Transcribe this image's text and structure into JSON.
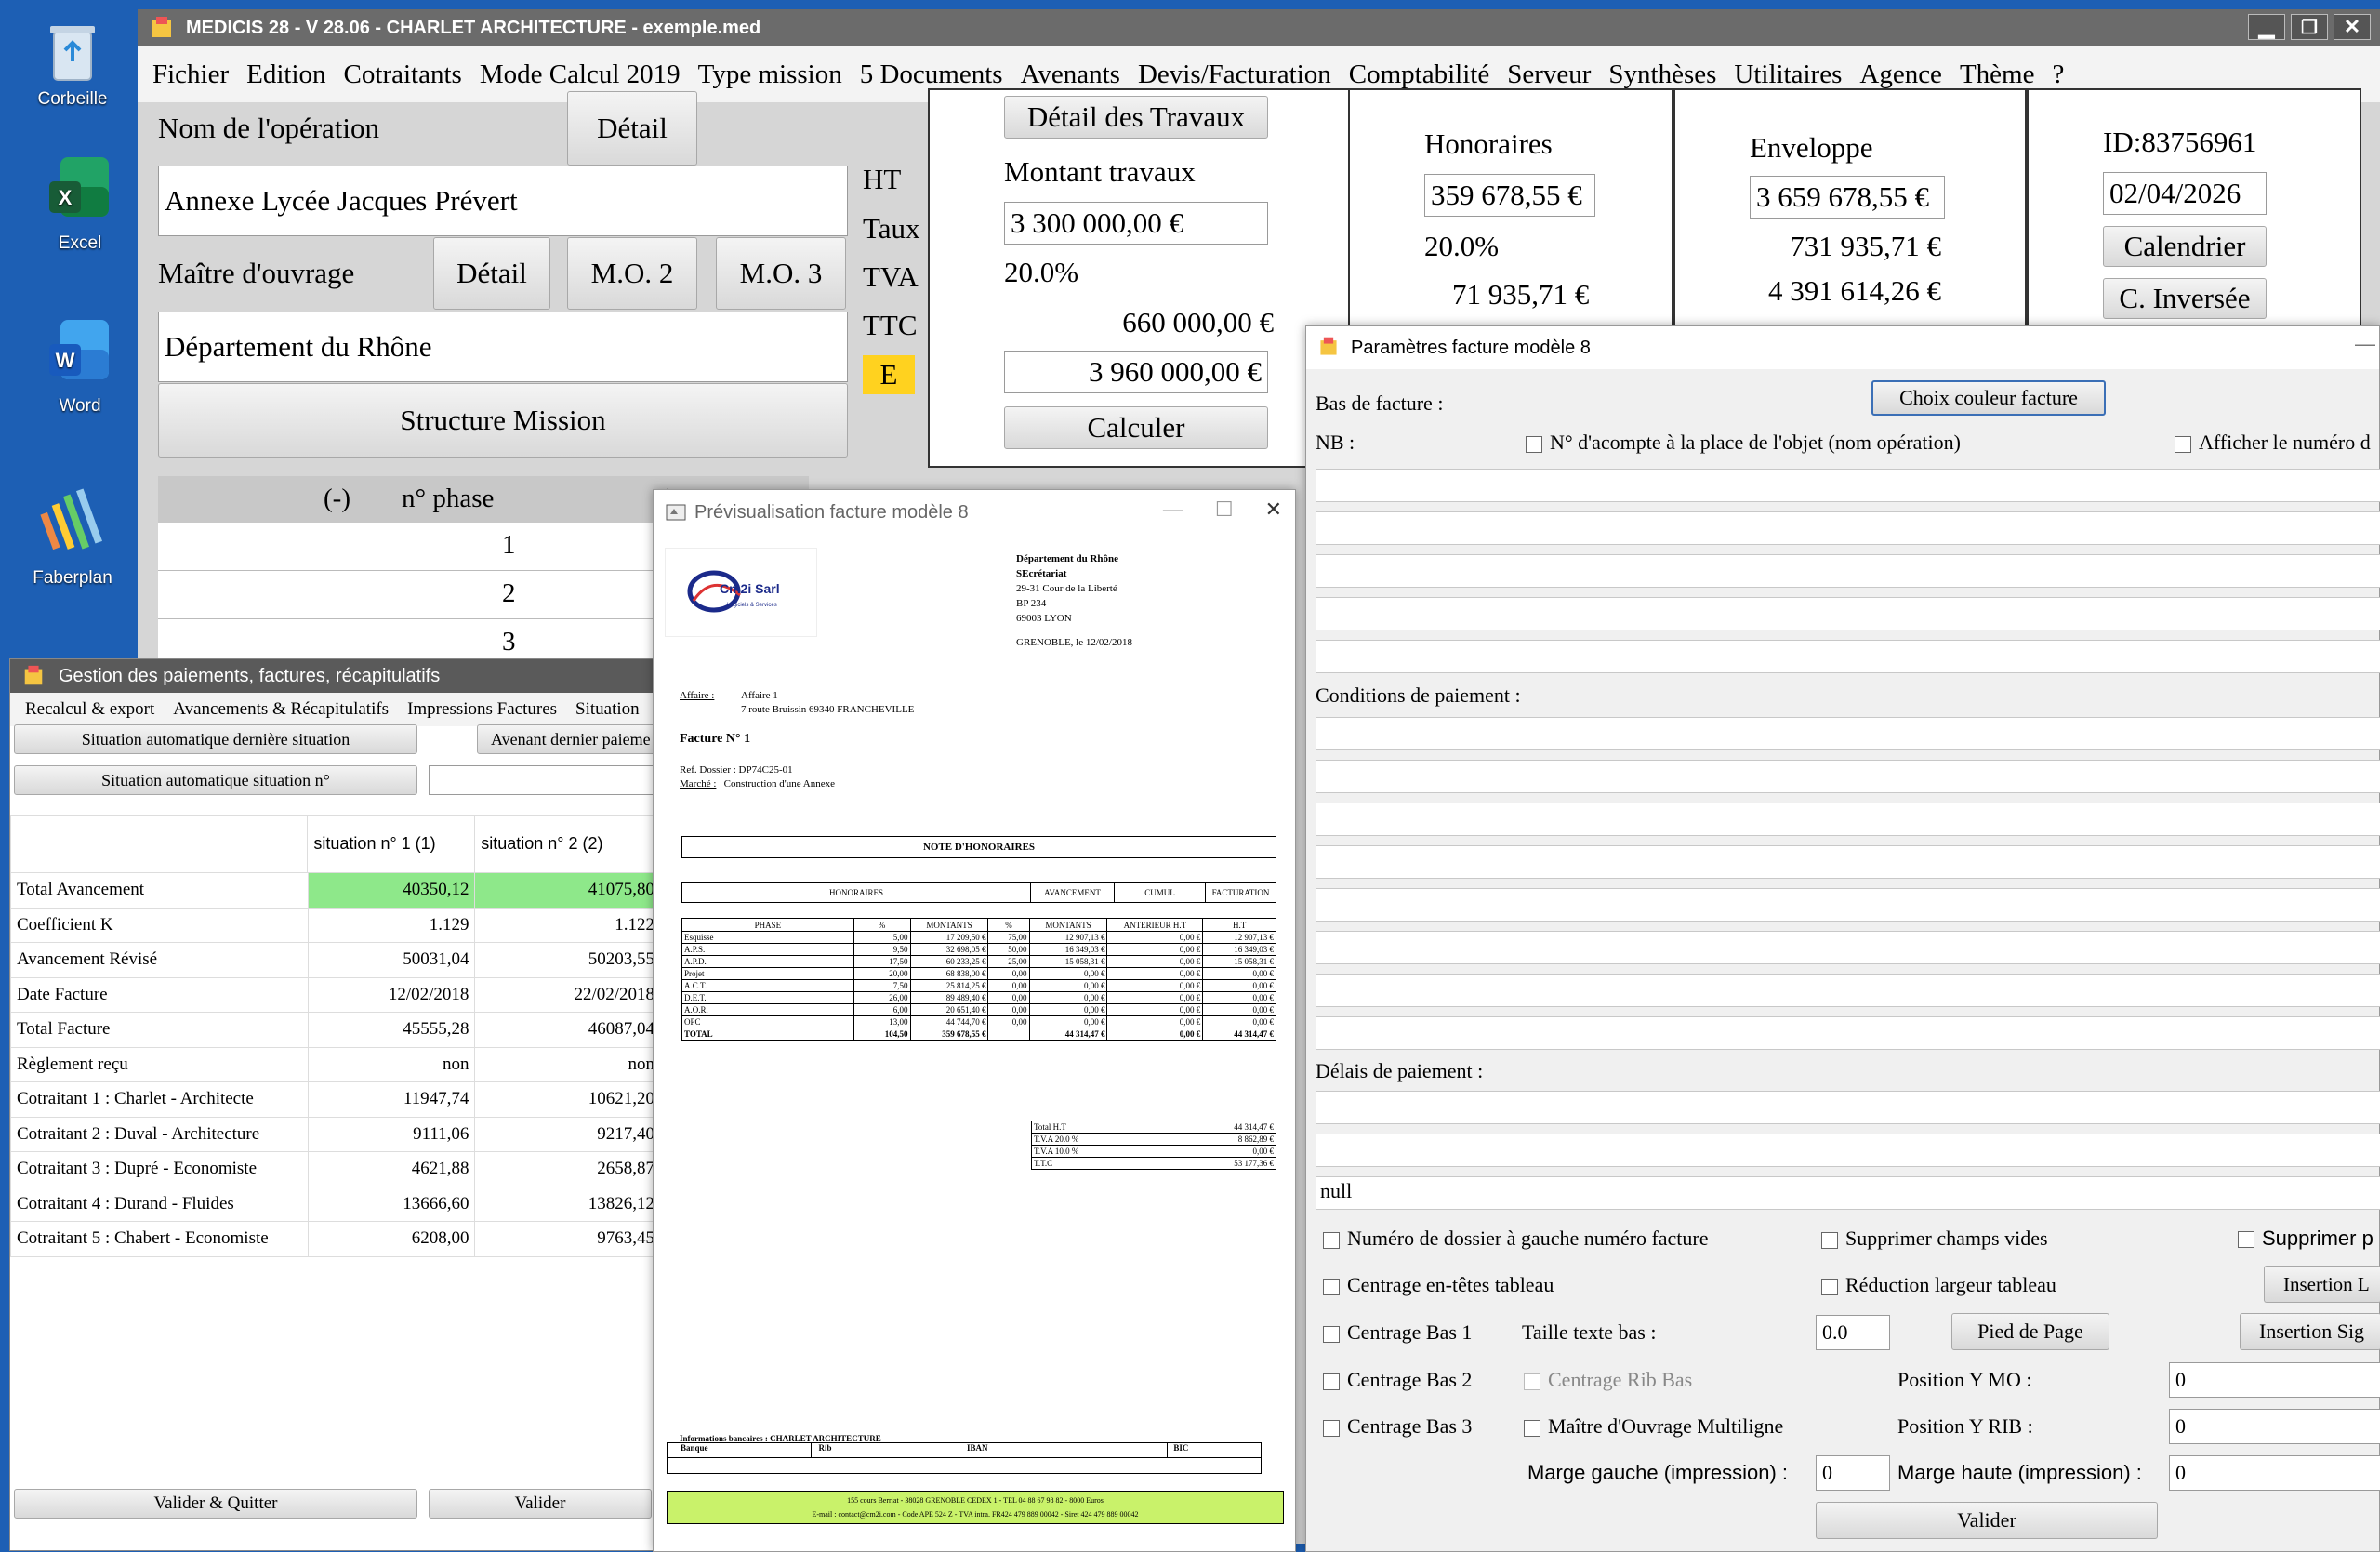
{
  "desktop": {
    "icons": [
      {
        "label": "Corbeille"
      },
      {
        "label": "Excel"
      },
      {
        "label": "Word"
      },
      {
        "label": "Faberplan"
      }
    ]
  },
  "main": {
    "title": "MEDICIS 28   - V 28.06 - CHARLET ARCHITECTURE - exemple.med",
    "menu": [
      "Fichier",
      "Edition",
      "Cotraitants",
      "Mode Calcul 2019",
      "Type mission",
      "5 Documents",
      "Avenants",
      "Devis/Facturation",
      "Comptabilité",
      "Serveur",
      "Synthèses",
      "Utilitaires",
      "Agence",
      "Thème",
      "?"
    ],
    "operation_label": "Nom de l'opération",
    "detail_label": "Détail",
    "operation_value": "Annexe Lycée Jacques Prévert",
    "mo_label": "Maître d'ouvrage",
    "mo2_label": "M.O. 2",
    "mo3_label": "M.O. 3",
    "mo_value": "Département du Rhône",
    "structure_label": "Structure Mission",
    "tax_labels": {
      "ht": "HT",
      "taux": "Taux",
      "tva": "TVA",
      "ttc": "TTC",
      "e": "E"
    },
    "travaux": {
      "detail_label": "Détail des Travaux",
      "montant_label": "Montant travaux",
      "montant_value": "3 300 000,00 €",
      "taux": "20.0%",
      "tva_value": "660 000,00 €",
      "ttc_value": "3 960 000,00 €",
      "calc_label": "Calculer"
    },
    "honoraires": {
      "label": "Honoraires",
      "value": "359 678,55 €",
      "taux": "20.0%",
      "tva": "71 935,71 €"
    },
    "enveloppe": {
      "label": "Enveloppe",
      "value": "3 659 678,55 €",
      "tva": "731 935,71 €",
      "ttc": "4 391 614,26 €"
    },
    "id_label": "ID:83756961",
    "date_value": "02/04/2026",
    "calendar_label": "Calendrier",
    "inverse_label": "C. Inversée",
    "phase_header": {
      "minus": "(-)",
      "phase": "n° phase",
      "plus": "("
    },
    "phase_rows": [
      "1",
      "2",
      "3"
    ]
  },
  "gestion": {
    "title": "Gestion des paiements, factures, récapitulatifs",
    "menu": [
      "Recalcul & export",
      "Avancements & Récapitulatifs",
      "Impressions Factures",
      "Situation"
    ],
    "btn_auto_last": "Situation automatique dernière situation",
    "btn_avenant": "Avenant dernier paieme",
    "btn_auto_n": "Situation automatique situation n°",
    "columns": [
      "situation n° 1 (1)",
      "situation n° 2 (2)"
    ],
    "rows": [
      {
        "label": "Total Avancement",
        "v1": "40350,12",
        "v2": "41075,80"
      },
      {
        "label": "Coefficient K",
        "v1": "1.129",
        "v2": "1.122"
      },
      {
        "label": "Avancement Révisé",
        "v1": "50031,04",
        "v2": "50203,55"
      },
      {
        "label": "Date Facture",
        "v1": "12/02/2018",
        "v2": "22/02/2018"
      },
      {
        "label": "Total Facture",
        "v1": "45555,28",
        "v2": "46087,04"
      },
      {
        "label": "Règlement reçu",
        "v1": "non",
        "v2": "non"
      },
      {
        "label": "Cotraitant 1 : Charlet - Architecte",
        "v1": "11947,74",
        "v2": "10621,20"
      },
      {
        "label": "Cotraitant 2 : Duval - Architecture",
        "v1": "9111,06",
        "v2": "9217,40"
      },
      {
        "label": "Cotraitant 3 : Dupré - Economiste",
        "v1": "4621,88",
        "v2": "2658,87"
      },
      {
        "label": "Cotraitant 4 : Durand - Fluides",
        "v1": "13666,60",
        "v2": "13826,12"
      },
      {
        "label": "Cotraitant 5 : Chabert - Economiste",
        "v1": "6208,00",
        "v2": "9763,45"
      }
    ],
    "btn_valider_quitter": "Valider & Quitter",
    "btn_valider": "Valider"
  },
  "preview": {
    "title": "Prévisualisation facture modèle 8",
    "logo_text": "Cm2i Sarl",
    "logo_sub": "Logiciels & Services",
    "recipient": [
      "Département du Rhône",
      "SEcrétariat",
      "29-31 Cour de la Liberté",
      "BP 234",
      "69003 LYON"
    ],
    "place_date": "GRENOBLE, le 12/02/2018",
    "affaire_label": "Affaire :",
    "affaire_lines": [
      "Affaire 1",
      "7 route Bruissin 69340 FRANCHEVILLE"
    ],
    "facture_title": "Facture N° 1",
    "ref_label": "Ref. Dossier :",
    "ref_value": "DP74C25-01",
    "marche_label": "Marché :",
    "marche_value": "Construction d'une Annexe",
    "note_title": "NOTE D'HONORAIRES",
    "group_headers": [
      "HONORAIRES",
      "AVANCEMENT",
      "CUMUL",
      "FACTURATION"
    ],
    "table_headers": [
      "PHASE",
      "%",
      "MONTANTS",
      "%",
      "MONTANTS",
      "ANTERIEUR H.T",
      "H.T"
    ],
    "table_rows": [
      [
        "Esquisse",
        "5,00",
        "17 209,50 €",
        "75,00",
        "12 907,13 €",
        "0,00 €",
        "12 907,13 €"
      ],
      [
        "A.P.S.",
        "9,50",
        "32 698,05 €",
        "50,00",
        "16 349,03 €",
        "0,00 €",
        "16 349,03 €"
      ],
      [
        "A.P.D.",
        "17,50",
        "60 233,25 €",
        "25,00",
        "15 058,31 €",
        "0,00 €",
        "15 058,31 €"
      ],
      [
        "Projet",
        "20,00",
        "68 838,00 €",
        "0,00",
        "0,00 €",
        "0,00 €",
        "0,00 €"
      ],
      [
        "A.C.T.",
        "7,50",
        "25 814,25 €",
        "0,00",
        "0,00 €",
        "0,00 €",
        "0,00 €"
      ],
      [
        "D.E.T.",
        "26,00",
        "89 489,40 €",
        "0,00",
        "0,00 €",
        "0,00 €",
        "0,00 €"
      ],
      [
        "A.O.R.",
        "6,00",
        "20 651,40 €",
        "0,00",
        "0,00 €",
        "0,00 €",
        "0,00 €"
      ],
      [
        "OPC",
        "13,00",
        "44 744,70 €",
        "0,00",
        "0,00 €",
        "0,00 €",
        "0,00 €"
      ]
    ],
    "total_row": [
      "TOTAL",
      "104,50",
      "359 678,55 €",
      "",
      "44 314,47 €",
      "0,00 €",
      "44 314,47 €"
    ],
    "totals": [
      {
        "label": "Total H.T",
        "value": "44 314,47 €"
      },
      {
        "label": "T.V.A 20.0 %",
        "value": "8 862,89 €"
      },
      {
        "label": "T.V.A 10.0 %",
        "value": "0,00 €"
      },
      {
        "label": "T.T.C",
        "value": "53 177,36 €"
      }
    ],
    "bank_title": "Informations bancaires : CHARLET ARCHITECTURE",
    "bank_headers": [
      "Banque",
      "Rib",
      "IBAN",
      "BIC"
    ],
    "footer_line1": "155 cours Berriat - 38028 GRENOBLE CEDEX 1 - TEL 04 88 67 98 82 - 8000 Euros",
    "footer_line2": "E-mail : contact@cm2i.com - Code APE 524 Z - TVA intra. FR424 479 889 00042 - Siret 424 479 889 00042"
  },
  "params": {
    "title": "Paramètres facture modèle 8",
    "bas_label": "Bas de facture :",
    "couleur_label": "Choix couleur facture",
    "nb_label": "NB :",
    "acompte_label": "N° d'acompte à la place de l'objet (nom opération)",
    "afficher_label": "Afficher le numéro d",
    "conditions_label": "Conditions de paiement :",
    "delais_label": "Délais de paiement :",
    "null_value": "null",
    "chk_dossier": "Numéro de dossier à gauche numéro facture",
    "chk_suppr_vides": "Supprimer champs vides",
    "chk_suppr": "Supprimer p",
    "chk_centrage_tetes": "Centrage en-têtes tableau",
    "chk_reduction": "Réduction largeur tableau",
    "btn_insertion_l": "Insertion L",
    "chk_bas1": "Centrage Bas 1",
    "taille_label": "Taille texte bas :",
    "taille_value": "0.0",
    "pied_label": "Pied de Page",
    "btn_insertion_sig": "Insertion Sig",
    "chk_bas2": "Centrage Bas 2",
    "chk_rib": "Centrage Rib Bas",
    "pos_mo_label": "Position Y MO :",
    "pos_mo_value": "0",
    "chk_bas3": "Centrage Bas 3",
    "chk_multiligne": "Maître d'Ouvrage Multiligne",
    "pos_rib_label": "Position Y RIB :",
    "pos_rib_value": "0",
    "marge_gauche_label": "Marge gauche (impression) :",
    "marge_gauche_value": "0",
    "marge_haute_label": "Marge haute (impression) :",
    "marge_haute_value": "0",
    "valider_label": "Valider"
  }
}
